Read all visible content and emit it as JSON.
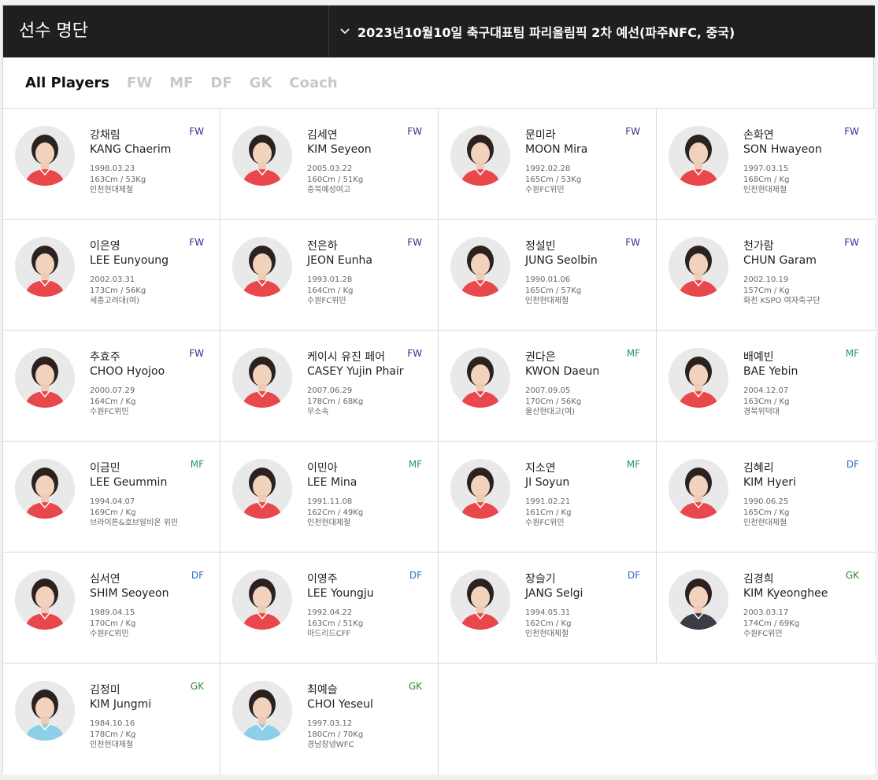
{
  "header": {
    "title": "선수 명단",
    "match": "2023년10월10일 축구대표팀 파리올림픽 2차 예선(파주NFC, 중국)"
  },
  "tabs": [
    "All Players",
    "FW",
    "MF",
    "DF",
    "GK",
    "Coach"
  ],
  "position_colors": {
    "FW": "#3b2a8e",
    "MF": "#1f9a5a",
    "DF": "#2f6fc2",
    "GK": "#2f8a2f"
  },
  "players": [
    {
      "kname": "강채림",
      "ename": "KANG Chaerim",
      "pos": "FW",
      "birth": "1998.03.23",
      "body": "163Cm / 53Kg",
      "club": "인천현대제철",
      "jersey": "red"
    },
    {
      "kname": "김세연",
      "ename": "KIM Seyeon",
      "pos": "FW",
      "birth": "2005.03.22",
      "body": "160Cm / 51Kg",
      "club": "충북예성여고",
      "jersey": "red"
    },
    {
      "kname": "문미라",
      "ename": "MOON Mira",
      "pos": "FW",
      "birth": "1992.02.28",
      "body": "165Cm / 53Kg",
      "club": "수원FC위민",
      "jersey": "red"
    },
    {
      "kname": "손화연",
      "ename": "SON Hwayeon",
      "pos": "FW",
      "birth": "1997.03.15",
      "body": "168Cm / Kg",
      "club": "인천현대제철",
      "jersey": "red"
    },
    {
      "kname": "이은영",
      "ename": "LEE Eunyoung",
      "pos": "FW",
      "birth": "2002.03.31",
      "body": "173Cm / 56Kg",
      "club": "세종고려대(여)",
      "jersey": "red"
    },
    {
      "kname": "전은하",
      "ename": "JEON Eunha",
      "pos": "FW",
      "birth": "1993.01.28",
      "body": "164Cm / Kg",
      "club": "수원FC위민",
      "jersey": "red"
    },
    {
      "kname": "정설빈",
      "ename": "JUNG Seolbin",
      "pos": "FW",
      "birth": "1990.01.06",
      "body": "165Cm / 57Kg",
      "club": "인천현대제철",
      "jersey": "red"
    },
    {
      "kname": "천가람",
      "ename": "CHUN Garam",
      "pos": "FW",
      "birth": "2002.10.19",
      "body": "157Cm / Kg",
      "club": "화천 KSPO 여자축구단",
      "jersey": "red"
    },
    {
      "kname": "추효주",
      "ename": "CHOO Hyojoo",
      "pos": "FW",
      "birth": "2000.07.29",
      "body": "164Cm / Kg",
      "club": "수원FC위민",
      "jersey": "red"
    },
    {
      "kname": "케이시 유진 페어",
      "ename": "CASEY Yujin Phair",
      "pos": "FW",
      "birth": "2007.06.29",
      "body": "178Cm / 68Kg",
      "club": "무소속",
      "jersey": "red"
    },
    {
      "kname": "권다은",
      "ename": "KWON Daeun",
      "pos": "MF",
      "birth": "2007.09.05",
      "body": "170Cm / 56Kg",
      "club": "울산현대고(여)",
      "jersey": "red"
    },
    {
      "kname": "배예빈",
      "ename": "BAE Yebin",
      "pos": "MF",
      "birth": "2004.12.07",
      "body": "163Cm / Kg",
      "club": "경북위덕대",
      "jersey": "red"
    },
    {
      "kname": "이금민",
      "ename": "LEE Geummin",
      "pos": "MF",
      "birth": "1994.04.07",
      "body": "169Cm / Kg",
      "club": "브라이튼&호브알비온 위민",
      "jersey": "red"
    },
    {
      "kname": "이민아",
      "ename": "LEE Mina",
      "pos": "MF",
      "birth": "1991.11.08",
      "body": "162Cm / 49Kg",
      "club": "인천현대제철",
      "jersey": "red"
    },
    {
      "kname": "지소연",
      "ename": "JI Soyun",
      "pos": "MF",
      "birth": "1991.02.21",
      "body": "161Cm / Kg",
      "club": "수원FC위민",
      "jersey": "red"
    },
    {
      "kname": "김혜리",
      "ename": "KIM Hyeri",
      "pos": "DF",
      "birth": "1990.06.25",
      "body": "165Cm / Kg",
      "club": "인천현대제철",
      "jersey": "red"
    },
    {
      "kname": "심서연",
      "ename": "SHIM Seoyeon",
      "pos": "DF",
      "birth": "1989.04.15",
      "body": "170Cm / Kg",
      "club": "수원FC위민",
      "jersey": "red"
    },
    {
      "kname": "이영주",
      "ename": "LEE Youngju",
      "pos": "DF",
      "birth": "1992.04.22",
      "body": "163Cm / 51Kg",
      "club": "마드리드CFF",
      "jersey": "red"
    },
    {
      "kname": "장슬기",
      "ename": "JANG Selgi",
      "pos": "DF",
      "birth": "1994.05.31",
      "body": "162Cm / Kg",
      "club": "인천현대제철",
      "jersey": "red"
    },
    {
      "kname": "김경희",
      "ename": "KIM Kyeonghee",
      "pos": "GK",
      "birth": "2003.03.17",
      "body": "174Cm / 69Kg",
      "club": "수원FC위민",
      "jersey": "dark"
    },
    {
      "kname": "김정미",
      "ename": "KIM Jungmi",
      "pos": "GK",
      "birth": "1984.10.16",
      "body": "178Cm / Kg",
      "club": "인천현대제철",
      "jersey": "blue"
    },
    {
      "kname": "최예슬",
      "ename": "CHOI Yeseul",
      "pos": "GK",
      "birth": "1997.03.12",
      "body": "180Cm / 70Kg",
      "club": "경남창녕WFC",
      "jersey": "blue"
    }
  ]
}
